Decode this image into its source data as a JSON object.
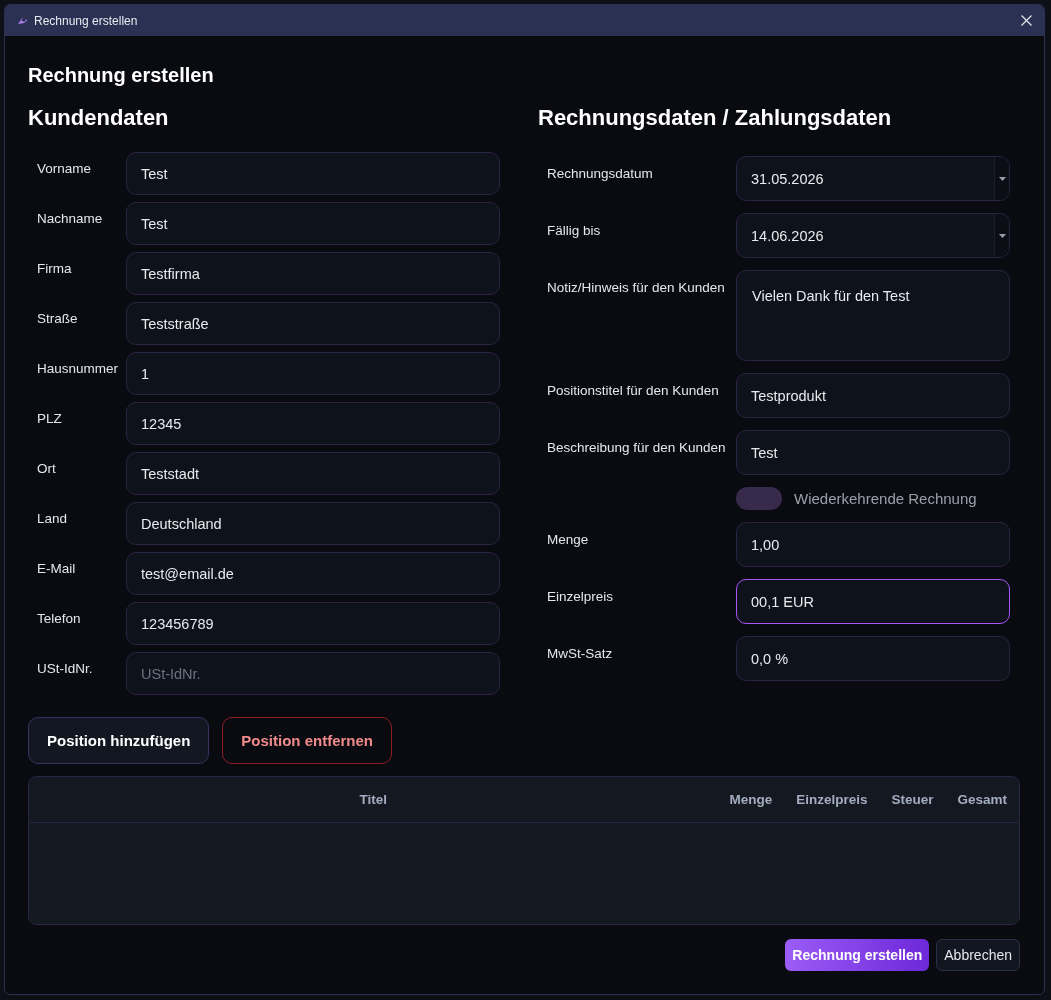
{
  "window": {
    "title": "Rechnung erstellen"
  },
  "heading": "Rechnung erstellen",
  "customer": {
    "title": "Kundendaten",
    "fields": [
      {
        "label": "Vorname",
        "value": "Test",
        "focused": false
      },
      {
        "label": "Nachname",
        "value": "Test",
        "focused": false
      },
      {
        "label": "Firma",
        "value": "Testfirma",
        "focused": false
      },
      {
        "label": "Straße",
        "value": "Teststraße",
        "focused": false
      },
      {
        "label": "Hausnummer",
        "value": "1",
        "focused": false
      },
      {
        "label": "PLZ",
        "value": "12345",
        "focused": false
      },
      {
        "label": "Ort",
        "value": "Teststadt",
        "focused": false
      },
      {
        "label": "Land",
        "value": "Deutschland",
        "focused": false
      },
      {
        "label": "E-Mail",
        "value": "test@email.de",
        "focused": false
      },
      {
        "label": "Telefon",
        "value": "123456789",
        "focused": false
      },
      {
        "label": "USt-IdNr.",
        "placeholder": "USt-IdNr.",
        "focused": false
      }
    ]
  },
  "invoice": {
    "title": "Rechnungsdaten / Zahlungsdaten",
    "fields": [
      {
        "kind": "date",
        "label": "Rechnungsdatum",
        "value": "31.05.2026",
        "focused": false
      },
      {
        "kind": "date",
        "label": "Fällig bis",
        "value": "14.06.2026",
        "focused": false
      },
      {
        "kind": "textarea",
        "label": "Notiz/Hinweis für den Kunden",
        "value": "Vielen Dank für den Test",
        "focused": false
      },
      {
        "kind": "text",
        "label": "Positionstitel für den Kunden",
        "value": "Testprodukt",
        "focused": false
      },
      {
        "kind": "text",
        "label": "Beschreibung für den Kunden",
        "value": "Test",
        "focused": false
      },
      {
        "kind": "toggle",
        "label": "Wiederkehrende Rechnung",
        "on": false
      },
      {
        "kind": "text",
        "label": "Menge",
        "value": "1,00",
        "focused": false
      },
      {
        "kind": "text",
        "label": "Einzelpreis",
        "value": "00,1 EUR",
        "focused": true
      },
      {
        "kind": "text",
        "label": "MwSt-Satz",
        "value": "0,0 %",
        "focused": false
      }
    ]
  },
  "position_buttons": [
    {
      "kind": "secondary",
      "label": "Position hinzufügen"
    },
    {
      "kind": "danger",
      "label": "Position entfernen"
    }
  ],
  "table": {
    "columns": [
      "Titel",
      "Menge",
      "Einzelpreis",
      "Steuer",
      "Gesamt"
    ]
  },
  "footer_buttons": [
    {
      "kind": "primary",
      "label": "Rechnung erstellen"
    },
    {
      "kind": "default",
      "label": "Abbrechen"
    }
  ]
}
